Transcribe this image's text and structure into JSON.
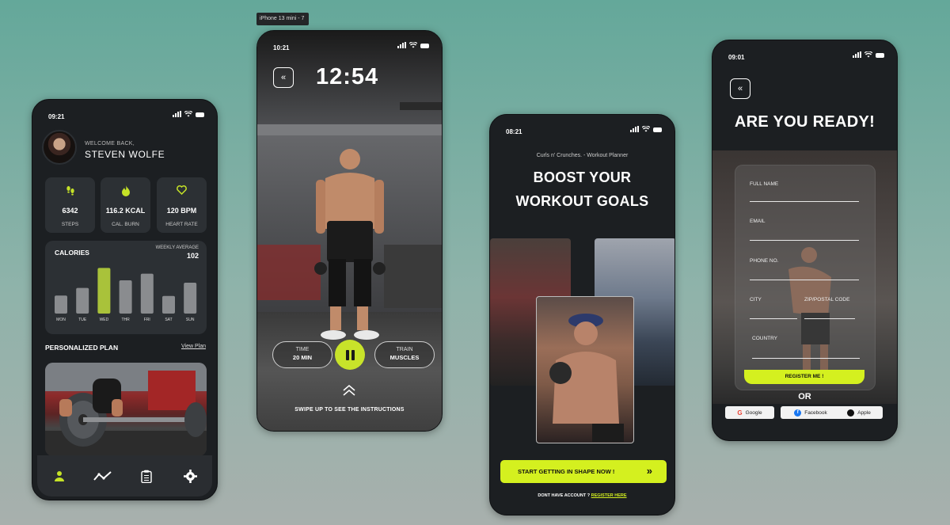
{
  "frame_label": "iPhone 13 mini - 7",
  "dashboard": {
    "time": "09:21",
    "welcome": "WELCOME BACK,",
    "name": "STEVEN WOLFE",
    "stats": [
      {
        "value": "6342",
        "label": "STEPS",
        "icon": "footsteps-icon"
      },
      {
        "value": "116.2 KCAL",
        "label": "CAL. BURN",
        "icon": "flame-icon"
      },
      {
        "value": "120 BPM",
        "label": "HEART RATE",
        "icon": "heart-icon"
      }
    ],
    "calories_title": "CALORIES",
    "weekly_avg_label": "WEEKLY AVERAGE",
    "weekly_avg_value": "102",
    "plan_title": "PERSONALIZED PLAN",
    "plan_link": "View Plan",
    "accent": "#c5e227"
  },
  "chart_data": {
    "type": "bar",
    "categories": [
      "MON",
      "TUE",
      "WED",
      "THR",
      "FRI",
      "SAT",
      "SUN"
    ],
    "values": [
      38,
      54,
      96,
      70,
      84,
      37,
      65
    ],
    "highlight": "WED",
    "ylim": [
      0,
      100
    ],
    "grid": false
  },
  "workout": {
    "time": "10:21",
    "clock": "12:54",
    "time_label": "TIME",
    "time_value": "20 MIN",
    "train_label": "TRAIN",
    "train_value": "MUSCLES",
    "swipe_text": "SWIPE UP TO SEE THE INSTRUCTIONS"
  },
  "onboarding": {
    "time": "08:21",
    "subtitle": "Curls n' Crunches. - Workout Planner",
    "headline_1": "BOOST YOUR",
    "headline_2": "WORKOUT GOALS",
    "cta": "START GETTING IN SHAPE NOW !",
    "footer_text": "DONT HAVE ACCOUNT ?",
    "footer_link": "REGISTER HERE"
  },
  "register": {
    "time": "09:01",
    "title": "ARE YOU READY!",
    "fields": {
      "full_name": "FULL NAME",
      "email": "EMAIL",
      "phone": "PHONE NO.",
      "city": "CITY",
      "zip": "ZIP/POSTAL CODE",
      "country": "COUNTRY"
    },
    "register_button": "REGISTER ME !",
    "or": "OR",
    "social": [
      "Google",
      "Facebook",
      "Apple"
    ]
  }
}
